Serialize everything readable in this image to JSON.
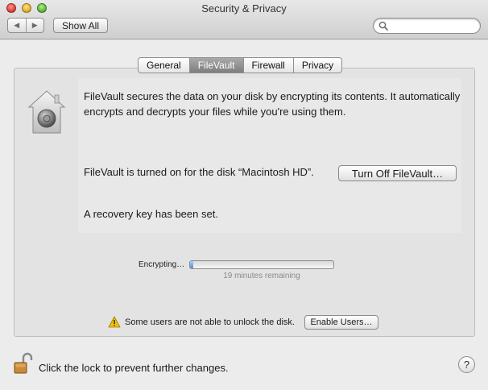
{
  "window": {
    "title": "Security & Privacy"
  },
  "toolbar": {
    "back_glyph": "◀",
    "forward_glyph": "▶",
    "show_all_label": "Show All",
    "search_placeholder": ""
  },
  "tabs": [
    {
      "label": "General",
      "active": false
    },
    {
      "label": "FileVault",
      "active": true
    },
    {
      "label": "Firewall",
      "active": false
    },
    {
      "label": "Privacy",
      "active": false
    }
  ],
  "filevault": {
    "description": "FileVault secures the data on your disk by encrypting its contents. It automatically encrypts and decrypts your files while you're using them.",
    "status_text": "FileVault is turned on for the disk “Macintosh HD”.",
    "turn_off_label": "Turn Off FileVault…",
    "recovery_text": "A recovery key has been set.",
    "encrypting_label": "Encrypting…",
    "progress_fraction": 0.02,
    "remaining_text": "19 minutes remaining",
    "warning_text": "Some users are not able to unlock the disk.",
    "enable_users_label": "Enable Users…"
  },
  "footer": {
    "lock_text": "Click the lock to prevent further changes.",
    "help_label": "?"
  },
  "icons": {
    "vault": "filevault-house-icon",
    "warning": "warning-triangle-icon",
    "lock": "padlock-open-icon",
    "search": "magnifier-icon"
  },
  "colors": {
    "active_tab": "#8c8c8c",
    "progress_blue": "#4e8fd8",
    "warning_yellow": "#f2c200"
  }
}
